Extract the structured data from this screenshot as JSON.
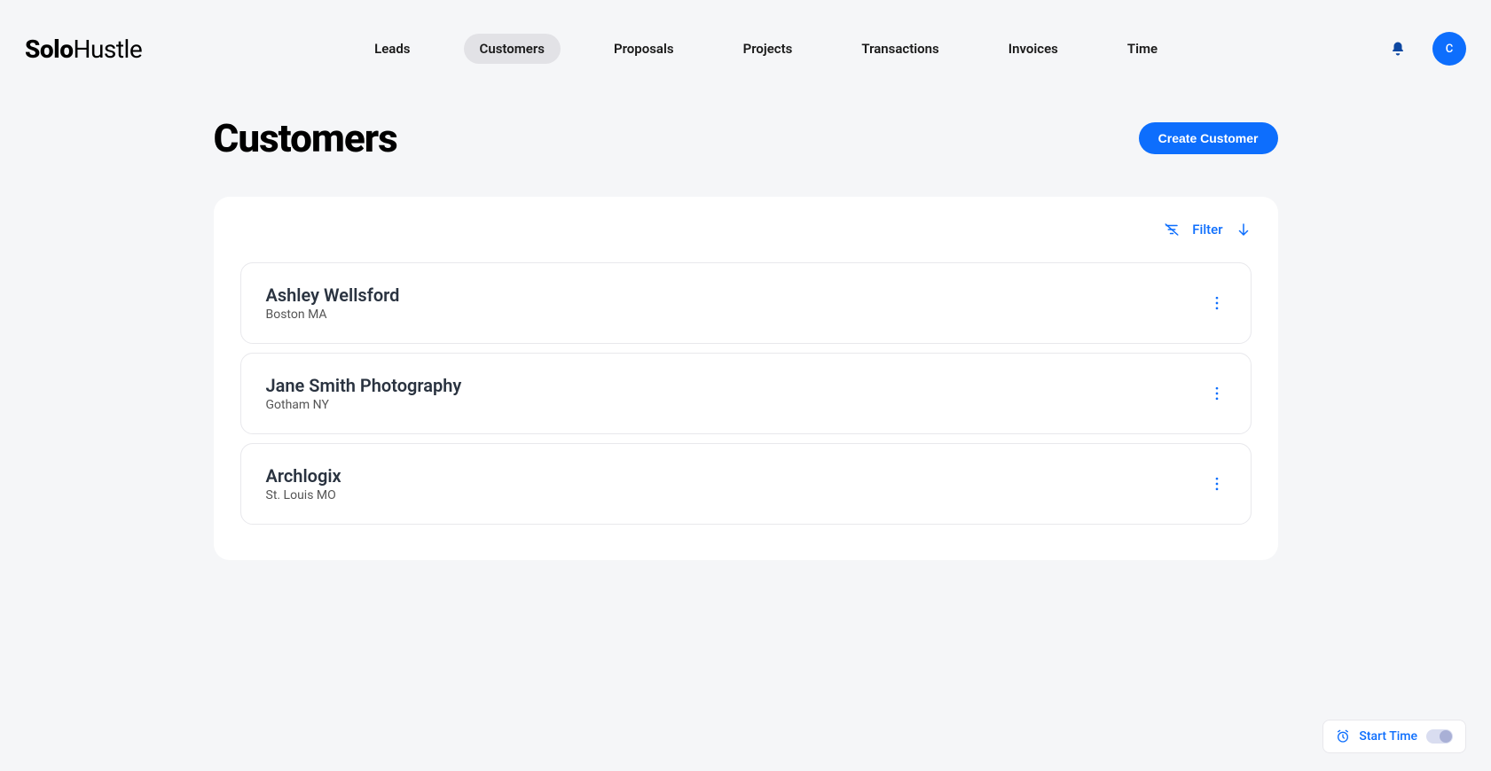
{
  "logo": {
    "bold": "Solo",
    "rest": "Hustle"
  },
  "nav": {
    "items": [
      "Leads",
      "Customers",
      "Proposals",
      "Projects",
      "Transactions",
      "Invoices",
      "Time"
    ],
    "activeIndex": 1
  },
  "avatar": {
    "initial": "C"
  },
  "page": {
    "title": "Customers",
    "createButton": "Create Customer"
  },
  "filter": {
    "label": "Filter"
  },
  "customers": [
    {
      "name": "Ashley Wellsford",
      "location": "Boston MA"
    },
    {
      "name": "Jane Smith Photography",
      "location": "Gotham NY"
    },
    {
      "name": "Archlogix",
      "location": "St. Louis MO"
    }
  ],
  "startTime": {
    "label": "Start Time"
  }
}
